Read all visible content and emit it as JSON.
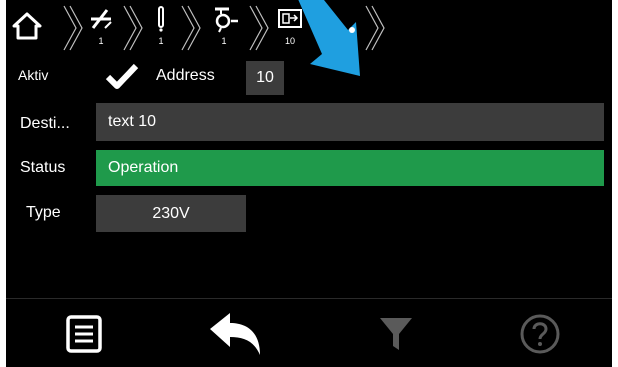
{
  "breadcrumb": {
    "items": [
      {
        "icon": "home-icon",
        "count": ""
      },
      {
        "icon": "crossed-line-icon",
        "count": "1"
      },
      {
        "icon": "exclamation-bar-icon",
        "count": "1"
      },
      {
        "icon": "lamp-icon",
        "count": "1"
      },
      {
        "icon": "exit-sign-icon",
        "count": "10"
      }
    ]
  },
  "form": {
    "aktiv_label": "Aktiv",
    "address_label": "Address",
    "address_value": "10",
    "destination_label": "Desti...",
    "destination_value": "text 10",
    "status_label": "Status",
    "status_value": "Operation",
    "type_label": "Type",
    "type_value": "230V"
  },
  "colors": {
    "background": "#000000",
    "field": "#3c3c3c",
    "status_ok": "#1f9a4b",
    "pointer_arrow": "#1f9fe0",
    "disabled_icon": "#5a5a5a"
  },
  "footer": {
    "buttons": [
      {
        "icon": "list-icon",
        "enabled": true
      },
      {
        "icon": "back-arrow-icon",
        "enabled": true
      },
      {
        "icon": "filter-icon",
        "enabled": false
      },
      {
        "icon": "help-icon",
        "enabled": false
      }
    ]
  }
}
